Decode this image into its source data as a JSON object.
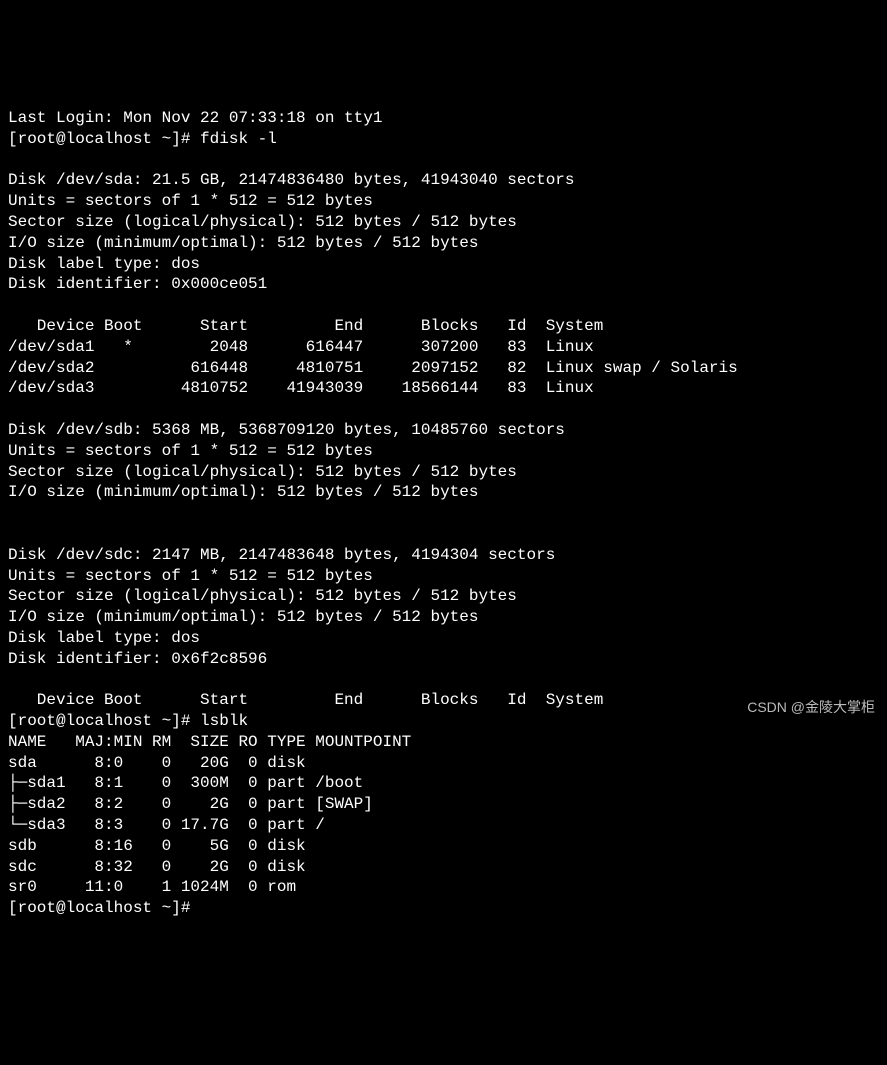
{
  "lines": {
    "l0": "Last Login: Mon Nov 22 07:33:18 on tty1",
    "prompt1": "[root@localhost ~]# ",
    "cmd1": "fdisk -l",
    "blank": "",
    "sda_header": "Disk /dev/sda: 21.5 GB, 21474836480 bytes, 41943040 sectors",
    "units": "Units = sectors of 1 * 512 = 512 bytes",
    "sector": "Sector size (logical/physical): 512 bytes / 512 bytes",
    "iosize": "I/O size (minimum/optimal): 512 bytes / 512 bytes",
    "labeldos": "Disk label type: dos",
    "ident_sda": "Disk identifier: 0x000ce051",
    "part_hdr": "   Device Boot      Start         End      Blocks   Id  System",
    "sda1": "/dev/sda1   *        2048      616447      307200   83  Linux",
    "sda2": "/dev/sda2          616448     4810751     2097152   82  Linux swap / Solaris",
    "sda3": "/dev/sda3         4810752    41943039    18566144   83  Linux",
    "sdb_header": "Disk /dev/sdb: 5368 MB, 5368709120 bytes, 10485760 sectors",
    "sdc_header": "Disk /dev/sdc: 2147 MB, 2147483648 bytes, 4194304 sectors",
    "ident_sdc": "Disk identifier: 0x6f2c8596",
    "part_hdr2": "   Device Boot      Start         End      Blocks   Id  System",
    "prompt2": "[root@localhost ~]# ",
    "cmd2": "lsblk",
    "lsblk_hdr": "NAME   MAJ:MIN RM  SIZE RO TYPE MOUNTPOINT",
    "lsblk_sda": "sda      8:0    0   20G  0 disk ",
    "lsblk_sda1": "├─sda1   8:1    0  300M  0 part /boot",
    "lsblk_sda2": "├─sda2   8:2    0    2G  0 part [SWAP]",
    "lsblk_sda3": "└─sda3   8:3    0 17.7G  0 part /",
    "lsblk_sdb": "sdb      8:16   0    5G  0 disk ",
    "lsblk_sdc": "sdc      8:32   0    2G  0 disk ",
    "lsblk_sr0": "sr0     11:0    1 1024M  0 rom  ",
    "prompt3": "[root@localhost ~]# "
  },
  "disks": {
    "sda": {
      "size_gb": 21.5,
      "bytes": 21474836480,
      "sectors": 41943040,
      "label": "dos",
      "identifier": "0x000ce051"
    },
    "sdb": {
      "size_mb": 5368,
      "bytes": 5368709120,
      "sectors": 10485760
    },
    "sdc": {
      "size_mb": 2147,
      "bytes": 2147483648,
      "sectors": 4194304,
      "label": "dos",
      "identifier": "0x6f2c8596"
    }
  },
  "partitions_sda": [
    {
      "device": "/dev/sda1",
      "boot": "*",
      "start": 2048,
      "end": 616447,
      "blocks": 307200,
      "id": "83",
      "system": "Linux"
    },
    {
      "device": "/dev/sda2",
      "boot": "",
      "start": 616448,
      "end": 4810751,
      "blocks": 2097152,
      "id": "82",
      "system": "Linux swap / Solaris"
    },
    {
      "device": "/dev/sda3",
      "boot": "",
      "start": 4810752,
      "end": 41943039,
      "blocks": 18566144,
      "id": "83",
      "system": "Linux"
    }
  ],
  "lsblk": [
    {
      "name": "sda",
      "majmin": "8:0",
      "rm": 0,
      "size": "20G",
      "ro": 0,
      "type": "disk",
      "mount": ""
    },
    {
      "name": "sda1",
      "majmin": "8:1",
      "rm": 0,
      "size": "300M",
      "ro": 0,
      "type": "part",
      "mount": "/boot"
    },
    {
      "name": "sda2",
      "majmin": "8:2",
      "rm": 0,
      "size": "2G",
      "ro": 0,
      "type": "part",
      "mount": "[SWAP]"
    },
    {
      "name": "sda3",
      "majmin": "8:3",
      "rm": 0,
      "size": "17.7G",
      "ro": 0,
      "type": "part",
      "mount": "/"
    },
    {
      "name": "sdb",
      "majmin": "8:16",
      "rm": 0,
      "size": "5G",
      "ro": 0,
      "type": "disk",
      "mount": ""
    },
    {
      "name": "sdc",
      "majmin": "8:32",
      "rm": 0,
      "size": "2G",
      "ro": 0,
      "type": "disk",
      "mount": ""
    },
    {
      "name": "sr0",
      "majmin": "11:0",
      "rm": 1,
      "size": "1024M",
      "ro": 0,
      "type": "rom",
      "mount": ""
    }
  ],
  "watermark": "CSDN @金陵大掌柜"
}
